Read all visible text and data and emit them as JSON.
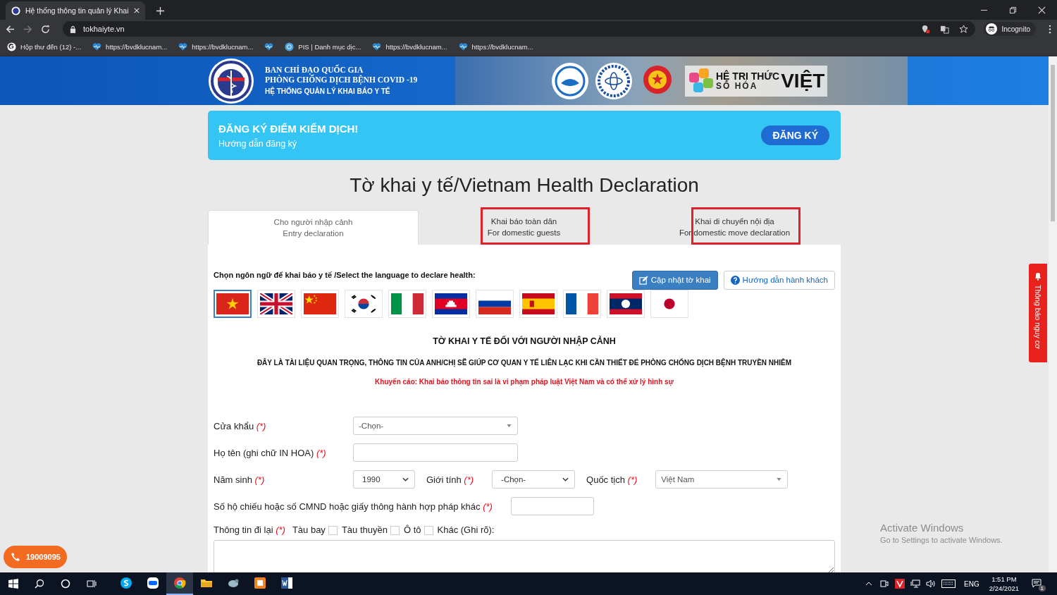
{
  "browser": {
    "tab_title": "Hệ thống thông tin quản lý Khai",
    "url": "tokhaiyte.vn",
    "profile": "Incognito",
    "bookmarks": [
      {
        "kind": "google",
        "label": "Hộp thư đến (12) -..."
      },
      {
        "kind": "heart",
        "label": "https://bvdklucnam..."
      },
      {
        "kind": "heart",
        "label": "https://bvdklucnam..."
      },
      {
        "kind": "heart"
      },
      {
        "kind": "globe",
        "label": "PIS | Danh mục dịc..."
      },
      {
        "kind": "heart",
        "label": "https://bvdklucnam..."
      },
      {
        "kind": "heart",
        "label": "https://bvdklucnam..."
      }
    ]
  },
  "banner": {
    "lines": [
      "BAN CHỈ ĐẠO QUỐC GIA",
      "PHÒNG CHỐNG DỊCH BỆNH COVID -19",
      "HỆ THỐNG QUẢN LÝ KHAI BÁO Y TẾ"
    ],
    "brand_top": "HỆ TRI THỨC",
    "brand_bottom": "SỐ HÓA",
    "brand_big": "VIỆT"
  },
  "notice": {
    "title": "ĐĂNG KÝ ĐIỂM KIỂM DỊCH!",
    "subtitle": "Hướng dẫn đăng ký",
    "button": "ĐĂNG KÝ"
  },
  "page_title": "Tờ khai y tế/Vietnam Health Declaration",
  "tabs": [
    {
      "line1": "Cho người nhập cảnh",
      "line2": "Entry declaration",
      "selected": true,
      "highlighted": false
    },
    {
      "line1": "Khai báo toàn dân",
      "line2": "For domestic guests",
      "selected": false,
      "highlighted": true
    },
    {
      "line1": "Khai di chuyển nội địa",
      "line2": "For domestic move declaration",
      "selected": false,
      "highlighted": true
    }
  ],
  "language_label": "Chọn ngôn ngữ để khai báo y tế /Select the language to declare health:",
  "buttons": [
    {
      "kind": "primary",
      "label": "Cập nhật tờ khai"
    },
    {
      "kind": "help",
      "label": "Hướng dẫn hành khách"
    }
  ],
  "flags": [
    {
      "kind": "vn",
      "selected": true
    },
    {
      "kind": "gb",
      "selected": false
    },
    {
      "kind": "cn",
      "selected": false
    },
    {
      "kind": "kr",
      "selected": false
    },
    {
      "kind": "it",
      "selected": false
    },
    {
      "kind": "kh",
      "selected": false
    },
    {
      "kind": "ru",
      "selected": false
    },
    {
      "kind": "es",
      "selected": false
    },
    {
      "kind": "fr",
      "selected": false
    },
    {
      "kind": "la",
      "selected": false
    },
    {
      "kind": "jp",
      "selected": false
    }
  ],
  "form_title": "TỜ KHAI Y TẾ ĐỐI VỚI NGƯỜI NHẬP CẢNH",
  "form_notice": "ĐÂY LÀ TÀI LIỆU QUAN TRỌNG, THÔNG TIN CỦA ANH/CHỊ SẼ GIÚP CƠ QUAN Y TẾ LIÊN LẠC KHI CẦN THIẾT ĐỂ PHÒNG CHỐNG DỊCH BỆNH TRUYỀN NHIỄM",
  "form_warning": "Khuyến cáo: Khai báo thông tin sai là vi phạm pháp luật Việt Nam và có thể xử lý hình sự",
  "rows": [
    {
      "items": [
        {
          "label": "Cửa khẩu",
          "required": "(*)",
          "kind": "combo",
          "value": "-Chọn-"
        }
      ]
    },
    {
      "items": [
        {
          "label": "Họ tên (ghi chữ IN HOA)",
          "required": "(*)",
          "kind": "text"
        }
      ]
    },
    {
      "items": [
        {
          "label": "Năm sinh",
          "required": "(*)",
          "kind": "select",
          "value": "1990"
        },
        {
          "label": "Giới tính",
          "required": "(*)",
          "kind": "select",
          "value": "-Chọn-"
        },
        {
          "label": "Quốc tịch",
          "required": "(*)",
          "kind": "combo",
          "value": "Việt Nam"
        }
      ]
    },
    {
      "items": [
        {
          "label": "Số hộ chiếu hoặc số CMND hoặc giấy thông hành hợp pháp khác",
          "required": "(*)",
          "kind": "text"
        }
      ]
    }
  ],
  "travel": {
    "label": "Thông tin đi lại",
    "required": "(*)",
    "options": [
      {
        "label": "Tàu bay",
        "checked": false
      },
      {
        "label": "Tàu thuyền",
        "checked": false
      },
      {
        "label": "Ô tô",
        "checked": false
      }
    ],
    "other_label": "Khác (Ghi rõ):"
  },
  "side_tab": "Thông báo nguy cơ",
  "hotline": "19009095",
  "os_notice": {
    "title": "Activate Windows",
    "subtitle": "Go to Settings to activate Windows."
  },
  "taskbar": {
    "apps": [
      {
        "kind": "skype",
        "active": false
      },
      {
        "kind": "zalo",
        "active": false
      },
      {
        "kind": "chrome",
        "active": true
      },
      {
        "kind": "folder",
        "active": false
      },
      {
        "kind": "app",
        "active": false
      },
      {
        "kind": "office",
        "active": false
      },
      {
        "kind": "word",
        "active": false
      }
    ],
    "language": "ENG",
    "time": "1:51 PM",
    "date": "2/24/2021",
    "notifications": "1"
  }
}
